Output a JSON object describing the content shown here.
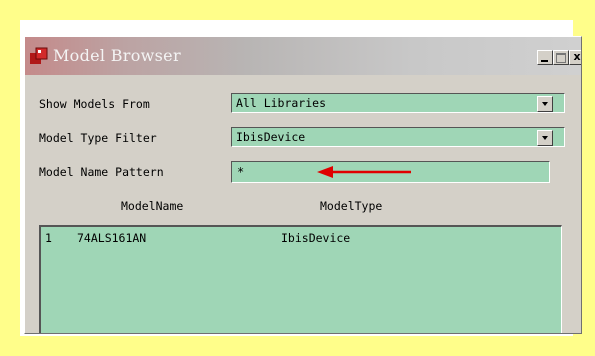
{
  "window": {
    "title": "Model Browser",
    "minimize_label": "_",
    "close_label": "x"
  },
  "form": {
    "show_models_from": {
      "label": "Show Models From",
      "value": "All Libraries"
    },
    "model_type_filter": {
      "label": "Model Type Filter",
      "value": "IbisDevice"
    },
    "model_name_pattern": {
      "label": "Model Name Pattern",
      "value": "*"
    }
  },
  "table": {
    "columns": [
      "ModelName",
      "ModelType"
    ],
    "rows": [
      {
        "index": "1",
        "name": "74ALS161AN",
        "type": "IbisDevice"
      }
    ]
  },
  "colors": {
    "background": "#fffe8a",
    "field": "#9fd6b6",
    "annotation_arrow": "#e00000"
  },
  "icons": [
    "app-icon",
    "minimize-icon",
    "maximize-icon",
    "close-icon",
    "dropdown-arrow-icon",
    "annotation-arrow"
  ]
}
